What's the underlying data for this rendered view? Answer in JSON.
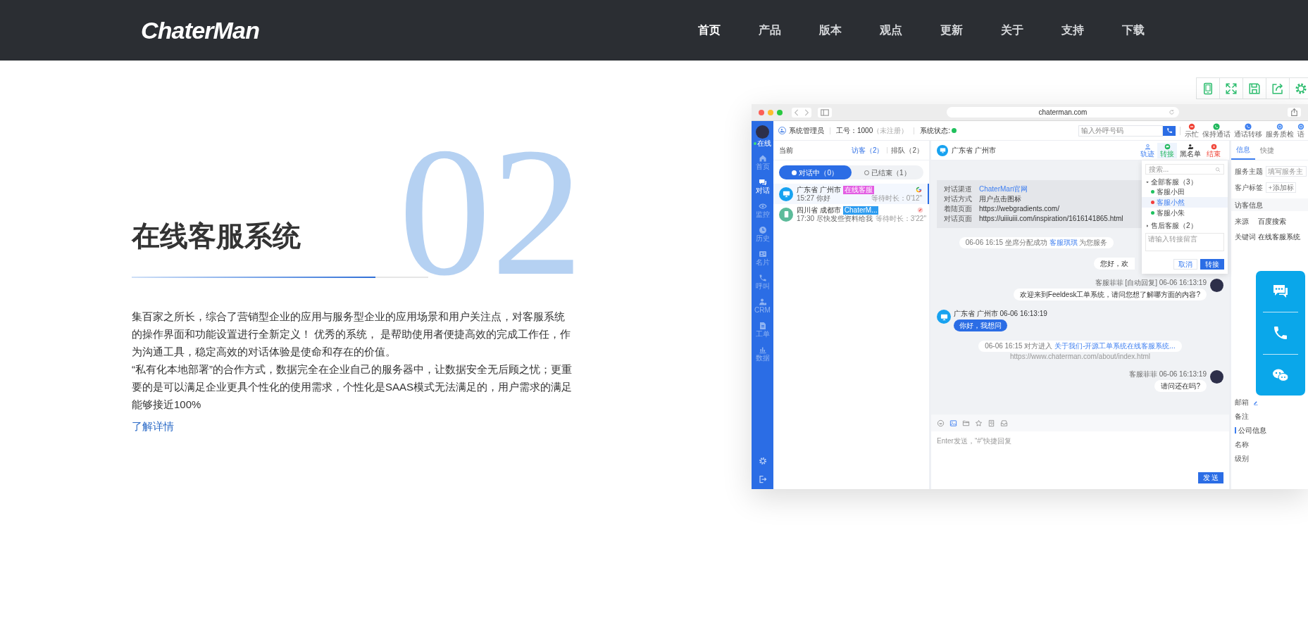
{
  "header": {
    "logo": "ChaterMan",
    "nav": [
      {
        "label": "首页",
        "selected": true
      },
      {
        "label": "产品",
        "selected": false
      },
      {
        "label": "版本",
        "selected": false
      },
      {
        "label": "观点",
        "selected": false
      },
      {
        "label": "更新",
        "selected": false
      },
      {
        "label": "关于",
        "selected": false
      },
      {
        "label": "支持",
        "selected": false
      },
      {
        "label": "下载",
        "selected": false
      }
    ]
  },
  "feature": {
    "number": "02",
    "title": "在线客服系统",
    "paragraphs": [
      "集百家之所长，综合了营销型企业的应用与服务型企业的应用场景和用户关注点，对客服系统的操作界面和功能设置进行全新定义！ 优秀的系统， 是帮助使用者便捷高效的完成工作任，作为沟通工具，稳定高效的对话体验是使命和存在的价值。",
      "“私有化本地部署”的合作方式，数据完全在企业自己的服务器中，让数据安全无后顾之忧；更重要的是可以满足企业更具个性化的使用需求，个性化是SAAS模式无法满足的，用户需求的满足能够接近100%"
    ],
    "link": "了解详情"
  },
  "toolbar": [
    {
      "kind": "tablet"
    },
    {
      "kind": "expand"
    },
    {
      "kind": "save"
    },
    {
      "kind": "share"
    },
    {
      "kind": "gear"
    }
  ],
  "app": {
    "browser": {
      "url": "chaterman.com"
    },
    "sidebar": {
      "status": "在线",
      "online": true,
      "items": [
        {
          "kind": "home",
          "label": "首页",
          "selected": false
        },
        {
          "kind": "chat",
          "label": "对话",
          "selected": true
        },
        {
          "kind": "eye",
          "label": "监控",
          "selected": false
        },
        {
          "kind": "clock",
          "label": "历史",
          "selected": false
        },
        {
          "kind": "card",
          "label": "名片",
          "selected": false
        },
        {
          "kind": "phone",
          "label": "呼叫",
          "selected": false
        },
        {
          "kind": "user",
          "label": "CRM",
          "selected": false
        },
        {
          "kind": "doc",
          "label": "工单",
          "selected": false
        },
        {
          "kind": "bars",
          "label": "数据",
          "selected": false
        }
      ],
      "bottom": [
        {
          "kind": "gear"
        },
        {
          "kind": "logout"
        }
      ]
    },
    "topbar": {
      "user": "系统管理员",
      "job_no": "工号：1000",
      "job_note": "（未注册）",
      "status_label": "系统状态:",
      "online": true,
      "dial_placeholder": "输入外呼号码",
      "actions": [
        {
          "kind": "busy",
          "label": "示忙"
        },
        {
          "kind": "hold",
          "label": "保持通话"
        },
        {
          "kind": "forward",
          "label": "通话转移"
        },
        {
          "kind": "inspect",
          "label": "服务质检"
        },
        {
          "kind": "more",
          "label": "语"
        }
      ]
    },
    "conversations": {
      "title": "当前",
      "tabs": [
        {
          "label": "访客（2）",
          "selected": true
        },
        {
          "label": "排队（2）",
          "selected": false
        }
      ],
      "toggle": [
        {
          "label": "对话中（0）",
          "selected": true
        },
        {
          "label": "已结束（1）",
          "selected": false
        }
      ],
      "items": [
        {
          "kind": "pc",
          "location": "广东省 广州市",
          "tag": "在线客服",
          "color": "#e35de3",
          "source": {
            "kind": "google"
          },
          "time": "15:27 你好",
          "wait": "等待时长：0'12\"",
          "selected": true
        },
        {
          "kind": "mobile",
          "location": "四川省 成都市",
          "tag": "ChaterM...",
          "color": "#2d9cf0",
          "source": {
            "kind": "other"
          },
          "time": "17:30 尽快发些资料给我",
          "wait": "等待时长：3'22\"",
          "selected": false
        }
      ]
    },
    "chat": {
      "title": "广东省 广州市",
      "actions": [
        {
          "kind": "track",
          "label": "轨迹",
          "selected": false
        },
        {
          "kind": "transfer",
          "label": "转接",
          "selected": true
        },
        {
          "kind": "blacklist",
          "label": "黑名单",
          "selected": false
        },
        {
          "kind": "end",
          "label": "结束",
          "selected": false
        }
      ],
      "info": [
        {
          "label": "对话渠道",
          "value": "ChaterMan官网",
          "link": true
        },
        {
          "label": "对话方式",
          "value": "用户点击图标",
          "link": false
        },
        {
          "label": "着陆页面",
          "value": "https://webgradients.com/",
          "link": false
        },
        {
          "label": "对话页面",
          "value": "https://uiiiuiii.com/inspiration/1616141865.html",
          "link": false
        }
      ],
      "messages": [
        {
          "kind": "system",
          "text": "06-06 16:15 坐席分配成功",
          "link": "客服琪琪",
          "suffix": "为您服务"
        },
        {
          "kind": "agent",
          "text": "您好，欢"
        },
        {
          "kind": "agent",
          "meta": "客服菲菲 [自动回复] 06-06 16:13:19",
          "text": "欢迎来到Feeldesk工单系统，请问您想了解哪方面的内容?"
        },
        {
          "kind": "visitor",
          "meta": "广东省 广州市 06-06 16:13:19",
          "text": "你好，我想问"
        },
        {
          "kind": "system",
          "text": "06-06 16:15 对方进入",
          "link": "关于我们-开源工单系统在线客服系统...",
          "url": "https://www.chaterman.com/about/index.html"
        },
        {
          "kind": "agent",
          "meta": "客服菲菲 06-06 16:13:19",
          "text": "请问还在吗?"
        }
      ],
      "composer": {
        "tools": [
          {
            "kind": "smile",
            "selected": false
          },
          {
            "kind": "image",
            "selected": true
          },
          {
            "kind": "folder",
            "selected": false
          },
          {
            "kind": "star",
            "selected": false
          },
          {
            "kind": "note",
            "selected": false
          },
          {
            "kind": "inbox",
            "selected": false
          }
        ],
        "placeholder": "Enter发送，“#”快捷回复",
        "send": "发 送"
      },
      "transfer": {
        "search_placeholder": "搜索...",
        "groups": [
          {
            "label": "全部客服（3）",
            "expanded": true,
            "children": [
              {
                "label": "客服小田",
                "color": "#1fc15f",
                "selected": false
              },
              {
                "label": "客服小然",
                "color": "#f23d3d",
                "selected": true
              },
              {
                "label": "客服小朱",
                "color": "#1fc15f",
                "selected": false
              }
            ]
          },
          {
            "label": "售后客服（2）",
            "expanded": false
          }
        ],
        "note_placeholder": "请输入转接留言",
        "buttons": [
          {
            "kind": "cancel",
            "label": "取消"
          },
          {
            "kind": "confirm",
            "label": "转接"
          }
        ]
      }
    },
    "details": {
      "tabs": [
        {
          "label": "信息",
          "selected": true
        },
        {
          "label": "快捷",
          "selected": false
        }
      ],
      "top_rows": [
        {
          "kind": "input",
          "label": "服务主题",
          "placeholder": "填写服务主"
        },
        {
          "kind": "add",
          "label": "客户标签",
          "value": "添加标"
        },
        {
          "kind": "section",
          "label": "访客信息"
        },
        {
          "kind": "pair",
          "label": "来源",
          "value": "百度搜索"
        },
        {
          "kind": "pair",
          "label": "关键词",
          "value": "在线客服系统"
        }
      ],
      "lower_rows": [
        {
          "kind": "edit",
          "label": "邮箱"
        },
        {
          "kind": "plain",
          "label": "备注"
        },
        {
          "kind": "heading",
          "label": "公司信息"
        },
        {
          "kind": "plain",
          "label": "名称"
        },
        {
          "kind": "plain",
          "label": "级别"
        }
      ]
    }
  },
  "widget": [
    {
      "kind": "chat"
    },
    {
      "kind": "phone"
    },
    {
      "kind": "wechat"
    }
  ]
}
